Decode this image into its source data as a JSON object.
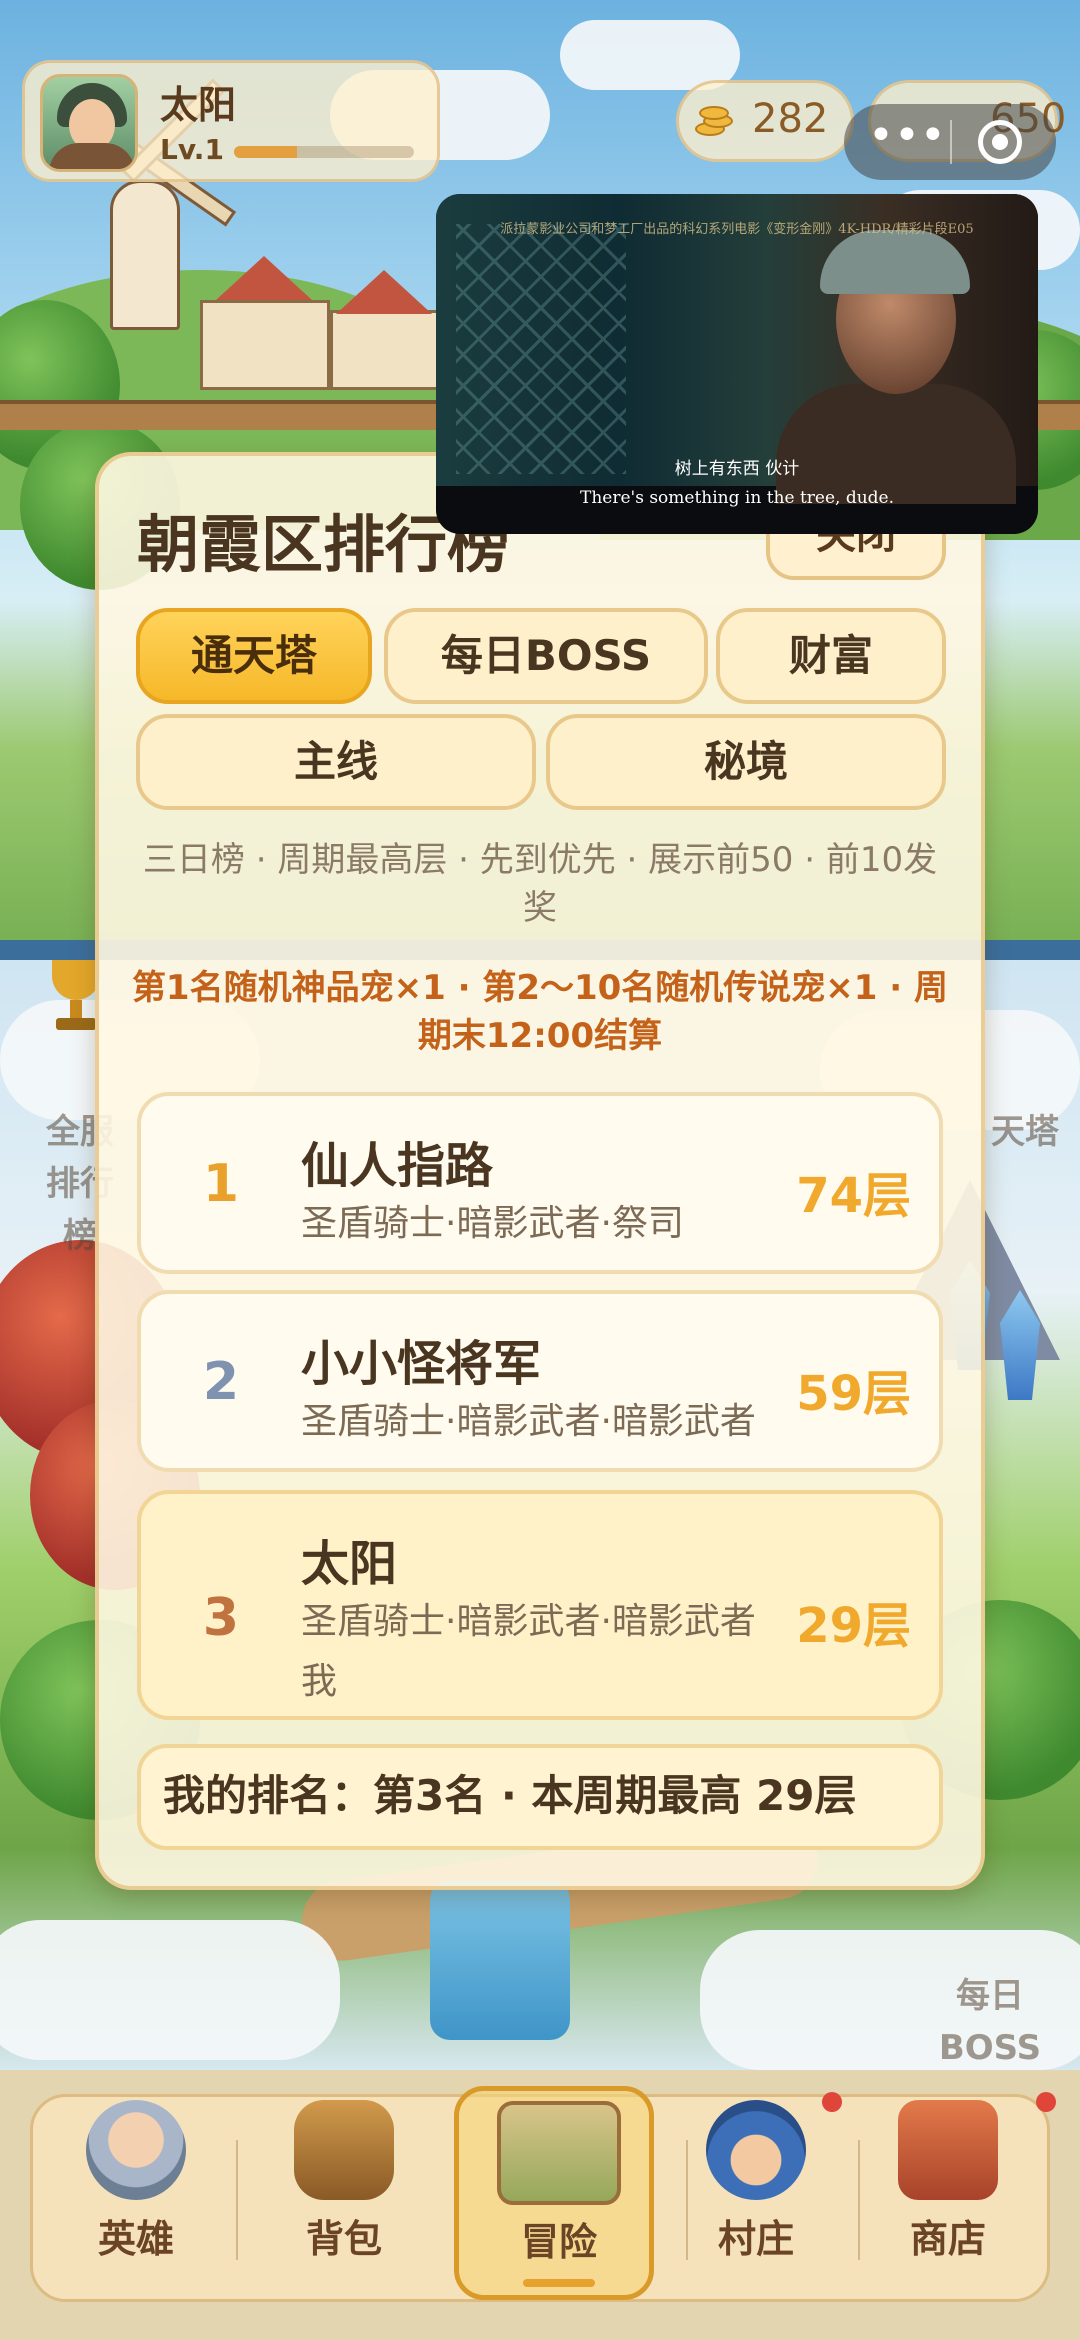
{
  "player": {
    "name": "太阳",
    "level": "Lv.1",
    "xp_progress": 0.35,
    "coins": "282",
    "gems": "650"
  },
  "capsule": {
    "more": "•••",
    "close": "target"
  },
  "video": {
    "banner": "派拉蒙影业公司和梦工厂出品的科幻系列电影《变形金刚》4K-HDR/精彩片段E05",
    "subtitle_cn": "树上有东西 伙计",
    "subtitle_en": "There's something in the tree, dude."
  },
  "side_labels": {
    "left": [
      "全服",
      "排行榜"
    ],
    "right": "天塔",
    "right_bottom": [
      "每日",
      "BOSS"
    ]
  },
  "leaderboard": {
    "title": "朝霞区排行榜",
    "close_label": "关闭",
    "tabs": [
      {
        "label": "通天塔",
        "active": true
      },
      {
        "label": "每日BOSS",
        "active": false
      },
      {
        "label": "财富",
        "active": false
      },
      {
        "label": "主线",
        "active": false
      },
      {
        "label": "秘境",
        "active": false
      }
    ],
    "description": "三日榜 · 周期最高层 · 先到优先 · 展示前50 · 前10发奖",
    "reward_text": "第1名随机神品宠×1 · 第2～10名随机传说宠×1 · 周期末12:00结算",
    "entries": [
      {
        "rank": "1",
        "name": "仙人指路",
        "team": "圣盾骑士·暗影武者·祭司",
        "score": "74层",
        "rank_color": "#e9a12c"
      },
      {
        "rank": "2",
        "name": "小小怪将军",
        "team": "圣盾骑士·暗影武者·暗影武者",
        "score": "59层",
        "rank_color": "#7f93b0"
      },
      {
        "rank": "3",
        "name": "太阳",
        "team": "圣盾骑士·暗影武者·暗影武者",
        "self_tag": "我",
        "score": "29层",
        "rank_color": "#c0733f"
      }
    ],
    "my_rank": "我的排名：第3名 · 本周期最高 29层"
  },
  "nav": {
    "items": [
      {
        "label": "英雄",
        "icon": "hero-icon",
        "active": false,
        "badge": false
      },
      {
        "label": "背包",
        "icon": "backpack-icon",
        "active": false,
        "badge": false
      },
      {
        "label": "冒险",
        "icon": "map-scroll-icon",
        "active": true,
        "badge": false
      },
      {
        "label": "村庄",
        "icon": "village-icon",
        "active": false,
        "badge": true
      },
      {
        "label": "商店",
        "icon": "shop-icon",
        "active": false,
        "badge": true
      }
    ]
  },
  "colors": {
    "accent": "#f6b829",
    "reward": "#c4621a",
    "score": "#f0a92c",
    "badge": "#e0453a"
  }
}
